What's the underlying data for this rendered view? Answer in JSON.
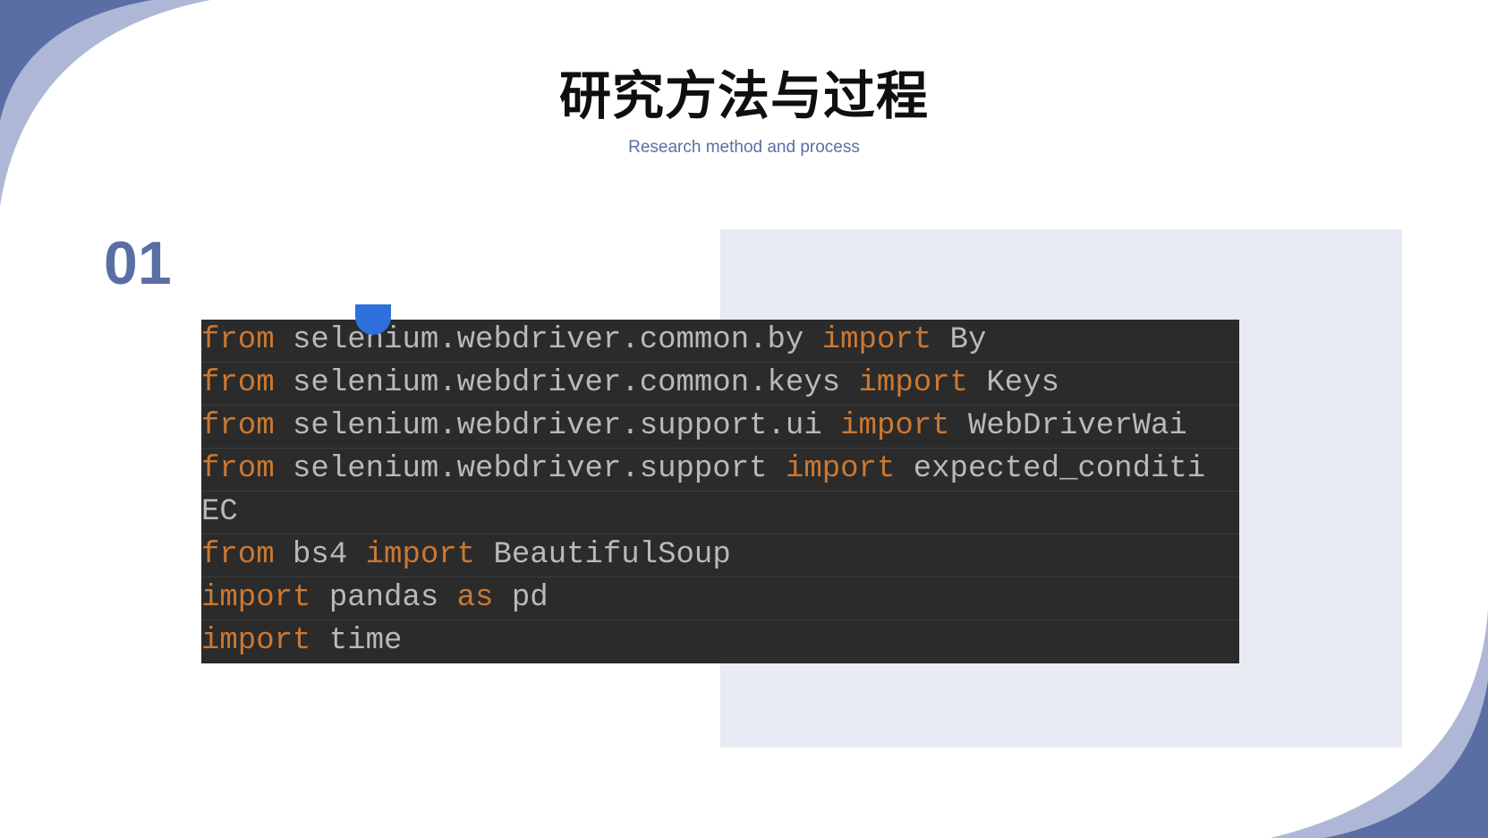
{
  "slide": {
    "title": "研究方法与过程",
    "subtitle": "Research method and process",
    "section_number": "01"
  },
  "colors": {
    "accent": "#5a6ea6",
    "accent_light": "#aeb8d6",
    "panel": "#e8ebf4",
    "code_bg": "#2b2b2b",
    "keyword": "#cc7832",
    "code_text": "#b9b9b9"
  },
  "code": {
    "lines": [
      {
        "k1": "from",
        "t1": " selenium.webdriver.common.by ",
        "k2": "import",
        "t2": " By"
      },
      {
        "k1": "from",
        "t1": " selenium.webdriver.common.keys ",
        "k2": "import",
        "t2": " Keys"
      },
      {
        "k1": "from",
        "t1": " selenium.webdriver.support.ui ",
        "k2": "import",
        "t2": " WebDriverWai"
      },
      {
        "k1": "from",
        "t1": " selenium.webdriver.support ",
        "k2": "import",
        "t2": " expected_conditi"
      },
      {
        "k1": "",
        "t1": "EC",
        "k2": "",
        "t2": ""
      },
      {
        "k1": "from",
        "t1": " bs4 ",
        "k2": "import",
        "t2": " BeautifulSoup"
      },
      {
        "k1": "import",
        "t1": " pandas ",
        "k2": "as",
        "t2": " pd"
      },
      {
        "k1": "import",
        "t1": " time",
        "k2": "",
        "t2": ""
      }
    ]
  }
}
